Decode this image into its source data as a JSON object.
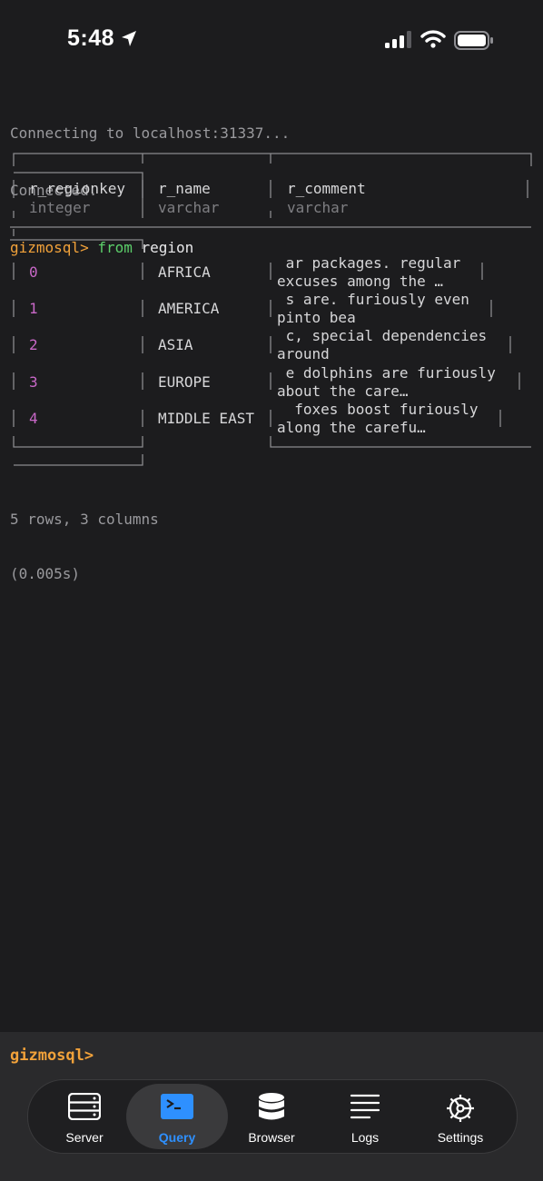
{
  "status_bar": {
    "time": "5:48"
  },
  "terminal": {
    "lines": [
      "Connecting to localhost:31337...",
      "Connected."
    ],
    "prompt": "gizmosql>",
    "keyword": "from",
    "argument": "region"
  },
  "table": {
    "columns": [
      {
        "name": "r_regionkey",
        "type": "integer"
      },
      {
        "name": "r_name",
        "type": "varchar"
      },
      {
        "name": "r_comment",
        "type": "varchar"
      }
    ],
    "rows": [
      {
        "key": "0",
        "name": "AFRICA",
        "comment1": " ar packages. regular",
        "comment2": "excuses among the …"
      },
      {
        "key": "1",
        "name": "AMERICA",
        "comment1": " s are. furiously even",
        "comment2": "pinto bea"
      },
      {
        "key": "2",
        "name": "ASIA",
        "comment1": " c, special dependencies",
        "comment2": "around"
      },
      {
        "key": "3",
        "name": "EUROPE",
        "comment1": " e dolphins are furiously",
        "comment2": "about the care…"
      },
      {
        "key": "4",
        "name": "MIDDLE EAST",
        "comment1": "  foxes boost furiously",
        "comment2": "along the carefu…"
      }
    ]
  },
  "summary": {
    "rows_cols": "5 rows, 3 columns",
    "elapsed": "(0.005s)"
  },
  "input": {
    "prompt": "gizmosql>"
  },
  "tabs": [
    {
      "label": "Server",
      "icon": "server-icon"
    },
    {
      "label": "Query",
      "icon": "terminal-icon",
      "active": true
    },
    {
      "label": "Browser",
      "icon": "database-icon"
    },
    {
      "label": "Logs",
      "icon": "list-icon"
    },
    {
      "label": "Settings",
      "icon": "gear-icon"
    }
  ],
  "colors": {
    "prompt": "#f2a23a",
    "keyword": "#5ccf6a",
    "key_values": "#c968c8",
    "active_tab": "#2e90ff"
  }
}
